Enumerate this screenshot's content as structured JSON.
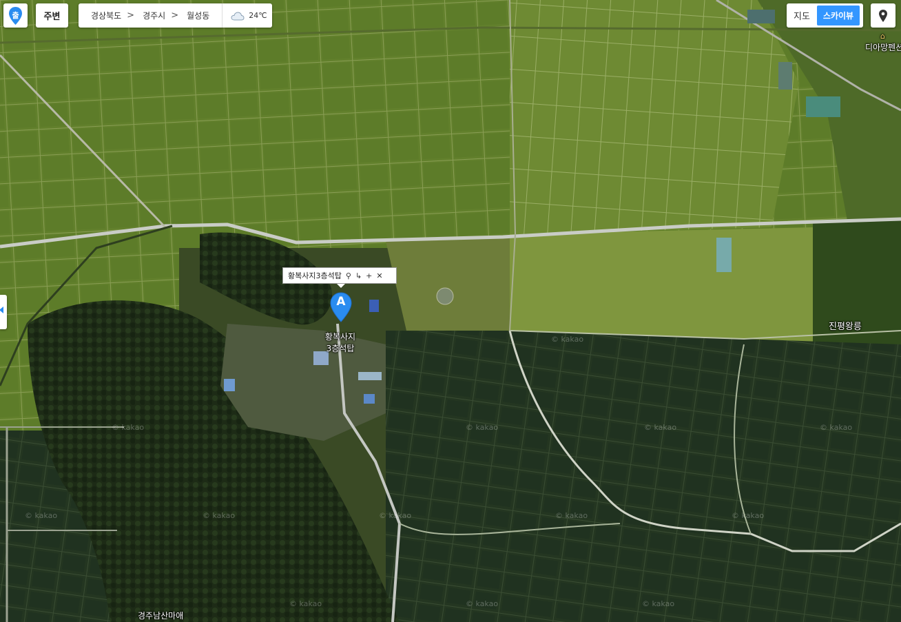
{
  "toolbar": {
    "start_label": "출",
    "around_label": "주변"
  },
  "breadcrumb": {
    "items": [
      "경상북도",
      "경주시",
      "월성동"
    ],
    "separators": [
      ">",
      ">"
    ],
    "weather_icon": "cloud-icon",
    "temperature": "24℃"
  },
  "map_type": {
    "map_label": "지도",
    "skyview_label": "스카이뷰",
    "active": "스카이뷰"
  },
  "marker": {
    "letter": "A",
    "title": "황복사지3층석탑",
    "place_label_line1": "황복사지",
    "place_label_line2": "3층석탑",
    "tool_icons": [
      "pin-icon",
      "route-icon",
      "plus-icon",
      "close-icon"
    ]
  },
  "places": {
    "jinpyeong": "진평왕릉",
    "diamond_pension": "디아망펜션",
    "namsan": "경주남산마애"
  },
  "watermark": "© kakao",
  "colors": {
    "accent": "#3396ff",
    "marker": "#2a8cf0"
  }
}
